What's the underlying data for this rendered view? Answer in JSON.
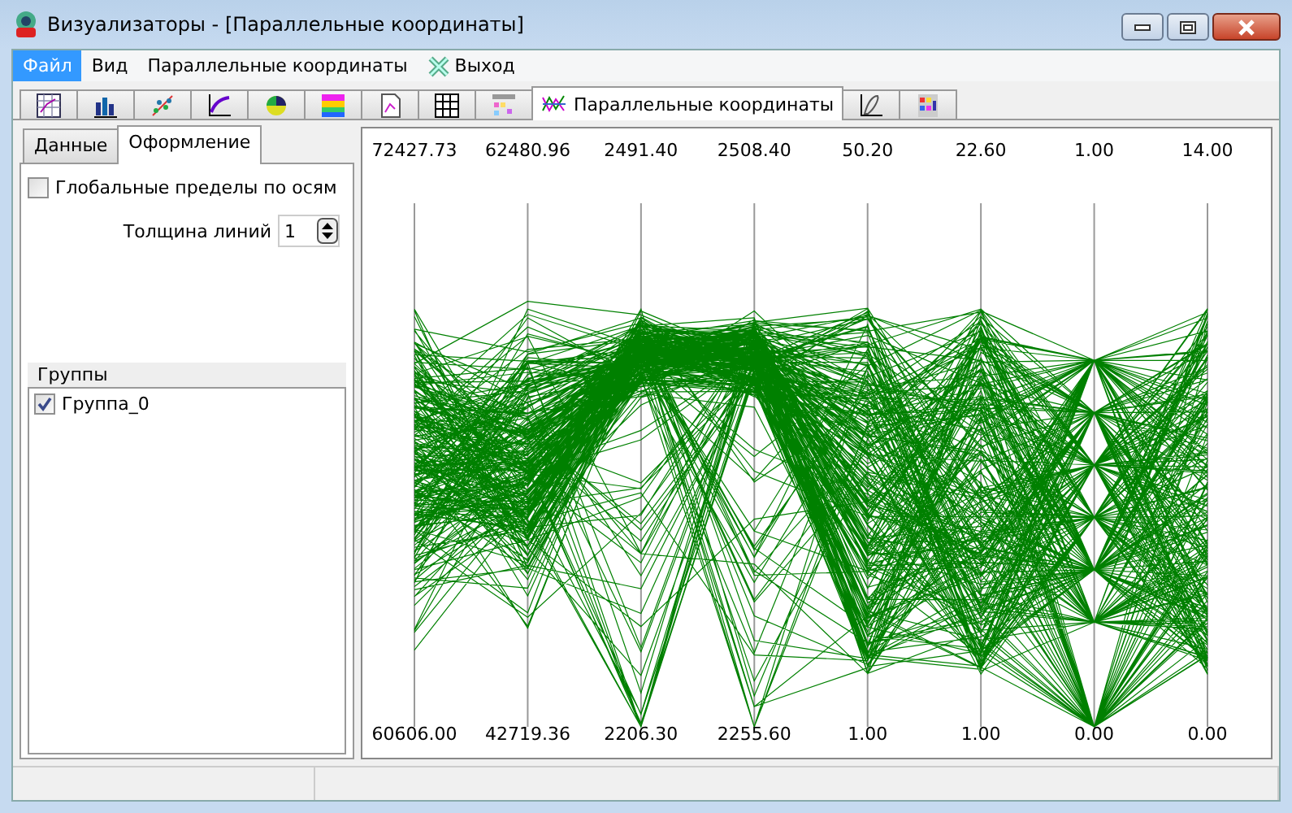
{
  "window": {
    "title": "Визуализаторы - [Параллельные координаты]"
  },
  "menu": [
    {
      "label": "Файл",
      "selected": true
    },
    {
      "label": "Вид",
      "selected": false
    },
    {
      "label": "Параллельные координаты",
      "selected": false
    },
    {
      "label": "Выход",
      "selected": false,
      "kind": "exit"
    }
  ],
  "toolbar_tabs": [
    {
      "selected": false
    },
    {
      "selected": false
    },
    {
      "selected": false
    },
    {
      "selected": false
    },
    {
      "selected": false
    },
    {
      "selected": false
    },
    {
      "selected": false
    },
    {
      "selected": false
    },
    {
      "selected": false
    },
    {
      "label": "Параллельные координаты",
      "selected": true
    },
    {
      "selected": false
    },
    {
      "selected": false
    }
  ],
  "side_tabs": [
    {
      "label": "Данные",
      "selected": false
    },
    {
      "label": "Оформление",
      "selected": true
    }
  ],
  "global_limits": {
    "label": "Глобальные пределы по осям",
    "checked": false
  },
  "line_width": {
    "label": "Толщина линий",
    "value": "1"
  },
  "groups": {
    "title": "Группы",
    "items": [
      {
        "label": "Группа_0",
        "checked": true
      }
    ]
  },
  "axes": [
    {
      "max": "72427.73",
      "min": "60606.00"
    },
    {
      "max": "62480.96",
      "min": "42719.36"
    },
    {
      "max": "2491.40",
      "min": "2206.30"
    },
    {
      "max": "2508.40",
      "min": "2255.60"
    },
    {
      "max": "50.20",
      "min": "1.00"
    },
    {
      "max": "22.60",
      "min": "1.00"
    },
    {
      "max": "1.00",
      "min": "0.00"
    },
    {
      "max": "14.00",
      "min": "0.00"
    }
  ]
}
